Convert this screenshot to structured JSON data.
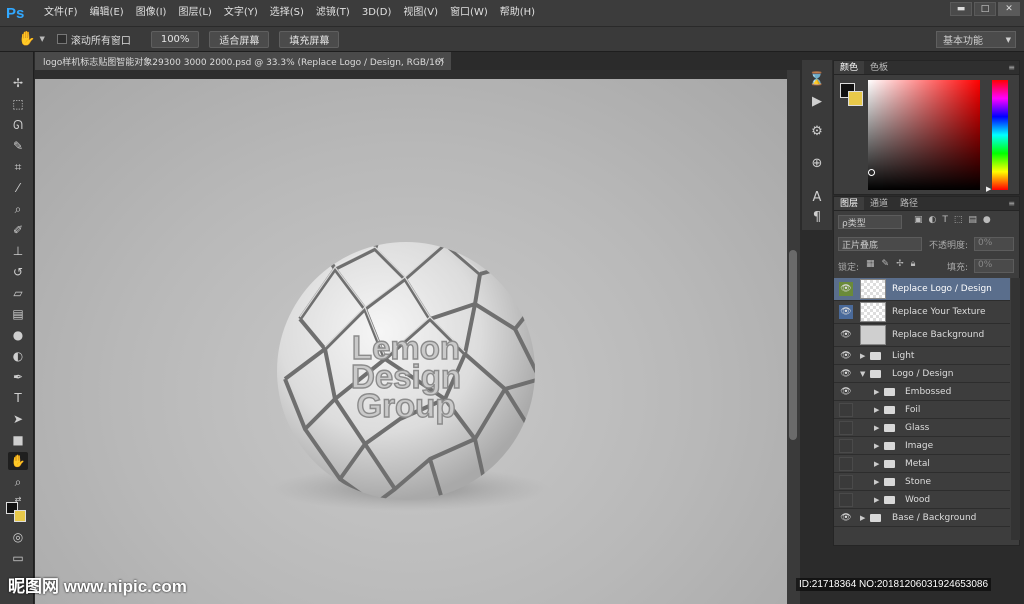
{
  "menubar": {
    "logo": "Ps",
    "items": [
      "文件(F)",
      "编辑(E)",
      "图像(I)",
      "图层(L)",
      "文字(Y)",
      "选择(S)",
      "滤镜(T)",
      "3D(D)",
      "视图(V)",
      "窗口(W)",
      "帮助(H)"
    ],
    "controls": [
      "▬",
      "□",
      "✕"
    ]
  },
  "options": {
    "scroll_all_label": "滚动所有窗口",
    "zoom_btn": "100%",
    "fit_screen_btn": "适合屏幕",
    "fill_screen_btn": "填充屏幕",
    "workspace": "基本功能"
  },
  "document": {
    "tab_title": "logo样机标志贴图智能对象29300 3000 2000.psd @ 33.3% (Replace Logo / Design, RGB/16)",
    "tab_close": "×",
    "logo_lines": [
      "Lemon",
      "Design",
      "Group"
    ]
  },
  "color_panel": {
    "tabs": [
      "颜色",
      "色板"
    ],
    "foreground_color": "#111111",
    "background_color": "#e8c94a"
  },
  "layers_panel": {
    "tabs": [
      "图层",
      "通道",
      "路径"
    ],
    "filter_kind": "ρ类型",
    "blend_mode": "正片叠底",
    "opacity_label": "不透明度:",
    "opacity_value": "0%",
    "lock_label": "锁定:",
    "fill_label": "填充:",
    "fill_value": "0%",
    "smart_layers": [
      {
        "name": "Replace Logo / Design",
        "eye_style": "green",
        "selected": true
      },
      {
        "name": "Replace Your Texture",
        "eye_style": "blue",
        "selected": false
      },
      {
        "name": "Replace Background",
        "eye_style": "normal",
        "selected": false
      }
    ],
    "groups": [
      {
        "name": "Light",
        "expanded": false,
        "visible": true,
        "indent": 0
      },
      {
        "name": "Logo / Design",
        "expanded": true,
        "visible": true,
        "indent": 0
      },
      {
        "name": "Embossed",
        "expanded": false,
        "visible": true,
        "indent": 1
      },
      {
        "name": "Foil",
        "expanded": false,
        "visible": false,
        "indent": 1
      },
      {
        "name": "Glass",
        "expanded": false,
        "visible": false,
        "indent": 1
      },
      {
        "name": "Image",
        "expanded": false,
        "visible": false,
        "indent": 1
      },
      {
        "name": "Metal",
        "expanded": false,
        "visible": false,
        "indent": 1
      },
      {
        "name": "Stone",
        "expanded": false,
        "visible": false,
        "indent": 1
      },
      {
        "name": "Wood",
        "expanded": false,
        "visible": false,
        "indent": 1
      },
      {
        "name": "Base / Background",
        "expanded": false,
        "visible": true,
        "indent": 0
      }
    ]
  },
  "watermark": {
    "left": "昵图网 www.nipic.com",
    "right": "ID:21718364 NO:20181206031924653086"
  }
}
